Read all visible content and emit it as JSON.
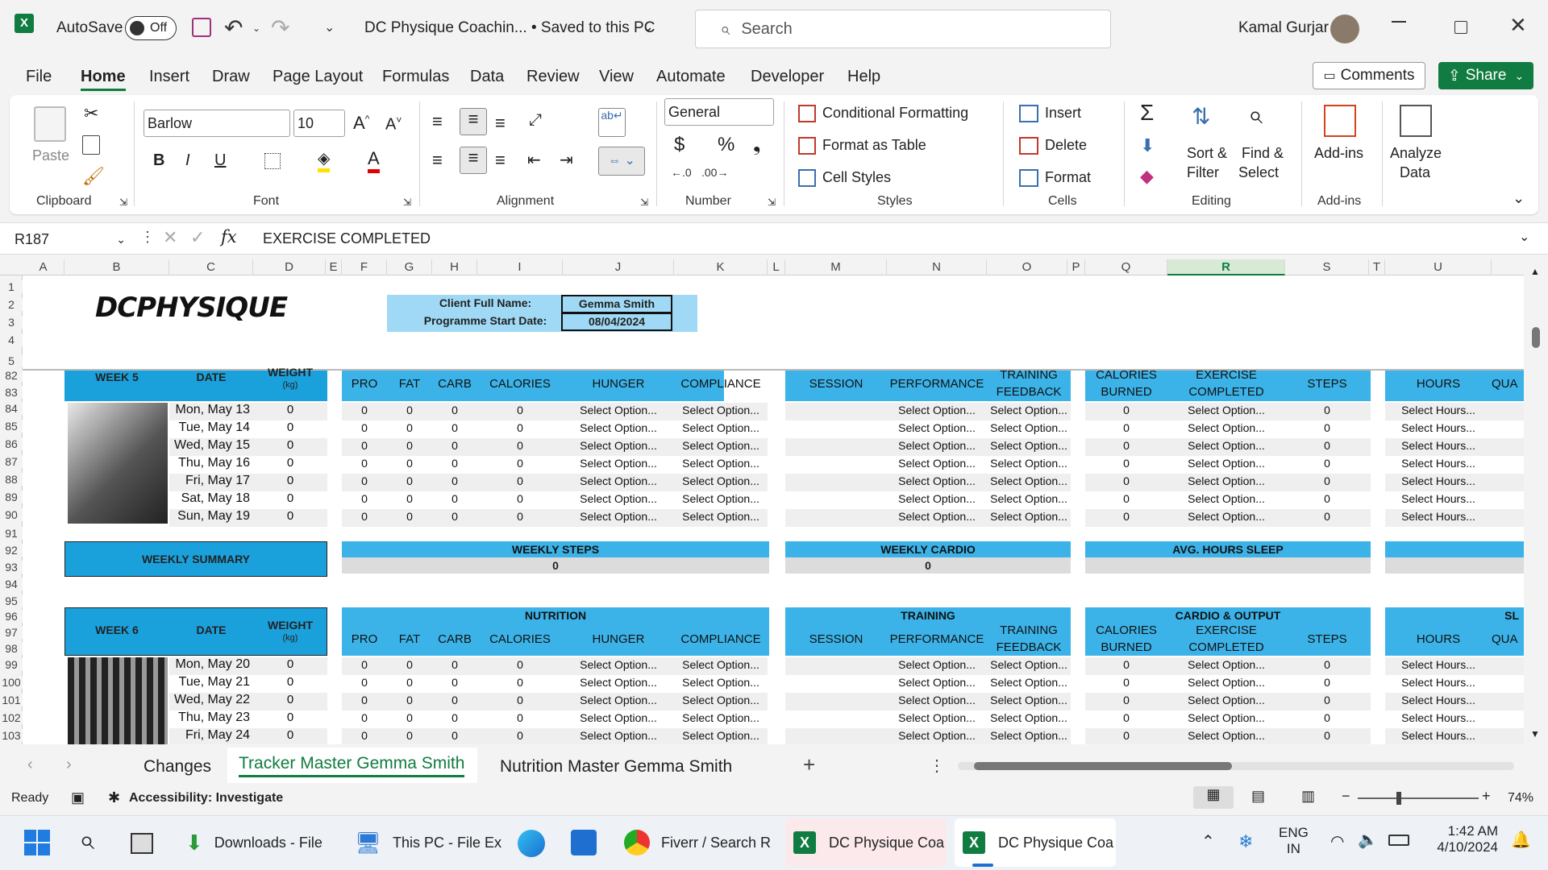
{
  "titlebar": {
    "autosave_label": "AutoSave",
    "autosave_state": "Off",
    "doc_title": "DC Physique Coachin...  •  Saved to this PC",
    "search_placeholder": "Search",
    "user_name": "Kamal Gurjar"
  },
  "menu": [
    "File",
    "Home",
    "Insert",
    "Draw",
    "Page Layout",
    "Formulas",
    "Data",
    "Review",
    "View",
    "Automate",
    "Developer",
    "Help"
  ],
  "menu_right": {
    "comments": "Comments",
    "share": "Share"
  },
  "ribbon": {
    "clipboard": {
      "paste": "Paste",
      "label": "Clipboard"
    },
    "font": {
      "name": "Barlow",
      "size": "10",
      "label": "Font"
    },
    "alignment": {
      "label": "Alignment"
    },
    "number": {
      "format": "General",
      "label": "Number"
    },
    "styles": {
      "conditional": "Conditional Formatting",
      "table": "Format as Table",
      "cell": "Cell Styles",
      "label": "Styles"
    },
    "cells": {
      "insert": "Insert",
      "delete": "Delete",
      "format": "Format",
      "label": "Cells"
    },
    "editing": {
      "sort1": "Sort &",
      "sort2": "Filter",
      "find1": "Find &",
      "find2": "Select",
      "label": "Editing"
    },
    "addins": {
      "addins": "Add-ins",
      "label": "Add-ins"
    },
    "analyze": {
      "l1": "Analyze",
      "l2": "Data"
    }
  },
  "formula": {
    "namebox": "R187",
    "content": "EXERCISE COMPLETED"
  },
  "columns": [
    "A",
    "B",
    "C",
    "D",
    "E",
    "F",
    "G",
    "H",
    "I",
    "J",
    "K",
    "L",
    "M",
    "N",
    "O",
    "P",
    "Q",
    "R",
    "S",
    "T",
    "U"
  ],
  "header_block": {
    "label_name": "Client Full Name:",
    "label_date": "Programme Start Date:",
    "client_name": "Gemma Smith",
    "start_date": "08/04/2024",
    "logo": "DCPHYSIQUE"
  },
  "week5": {
    "week": "WEEK 5",
    "date": "DATE",
    "weight": "WEIGHT",
    "weight_unit": "(kg)",
    "rows": [
      {
        "r": "84",
        "date": "Mon, May 13"
      },
      {
        "r": "85",
        "date": "Tue, May 14"
      },
      {
        "r": "86",
        "date": "Wed, May 15"
      },
      {
        "r": "87",
        "date": "Thu, May 16"
      },
      {
        "r": "88",
        "date": "Fri, May 17"
      },
      {
        "r": "89",
        "date": "Sat, May 18"
      },
      {
        "r": "90",
        "date": "Sun, May 19"
      }
    ]
  },
  "subheads": {
    "pro": "PRO",
    "fat": "FAT",
    "carb": "CARB",
    "calories": "CALORIES",
    "hunger": "HUNGER",
    "compliance": "COMPLIANCE",
    "session": "SESSION",
    "performance": "PERFORMANCE",
    "feedback1": "TRAINING",
    "feedback2": "FEEDBACK",
    "burned1": "CALORIES",
    "burned2": "BURNED",
    "exercise1": "EXERCISE",
    "exercise2": "COMPLETED",
    "steps": "STEPS",
    "hours": "HOURS",
    "qua": "QUA"
  },
  "cell_values": {
    "zero": "0",
    "select": "Select Option...",
    "hours": "Select Hours..."
  },
  "summary": {
    "label": "WEEKLY SUMMARY",
    "steps_label": "WEEKLY STEPS",
    "steps_value": "0",
    "cardio_label": "WEEKLY CARDIO",
    "cardio_value": "0",
    "sleep_label": "AVG. HOURS SLEEP"
  },
  "sections": {
    "nutrition": "NUTRITION",
    "training": "TRAINING",
    "cardio": "CARDIO & OUTPUT",
    "sl": "SL"
  },
  "week6": {
    "week": "WEEK 6",
    "date": "DATE",
    "weight": "WEIGHT",
    "weight_unit": "(kg)",
    "rows": [
      {
        "r": "99",
        "date": "Mon, May 20"
      },
      {
        "r": "100",
        "date": "Tue, May 21"
      },
      {
        "r": "101",
        "date": "Wed, May 22"
      },
      {
        "r": "102",
        "date": "Thu, May 23"
      },
      {
        "r": "103",
        "date": "Fri, May 24"
      }
    ]
  },
  "row_numbers_top": [
    "1",
    "2",
    "3",
    "4",
    "5",
    "82",
    "83"
  ],
  "row_numbers_mid": [
    "91",
    "92",
    "93",
    "94",
    "95",
    "96",
    "97",
    "98"
  ],
  "tabs": [
    "Changes",
    "Tracker Master Gemma Smith",
    "Nutrition Master Gemma Smith"
  ],
  "status": {
    "ready": "Ready",
    "accessibility": "Accessibility: Investigate",
    "zoom": "74%"
  },
  "taskbar": {
    "items": [
      "Downloads - File",
      "This PC - File Ex",
      "Fiverr / Search R",
      "DC Physique Coa",
      "DC Physique Coa"
    ],
    "lang1": "ENG",
    "lang2": "IN",
    "time": "1:42 AM",
    "date": "4/10/2024"
  },
  "colors": {
    "header_blue": "#3cb3e8",
    "excel_green": "#107c41",
    "band": "#efefef"
  }
}
